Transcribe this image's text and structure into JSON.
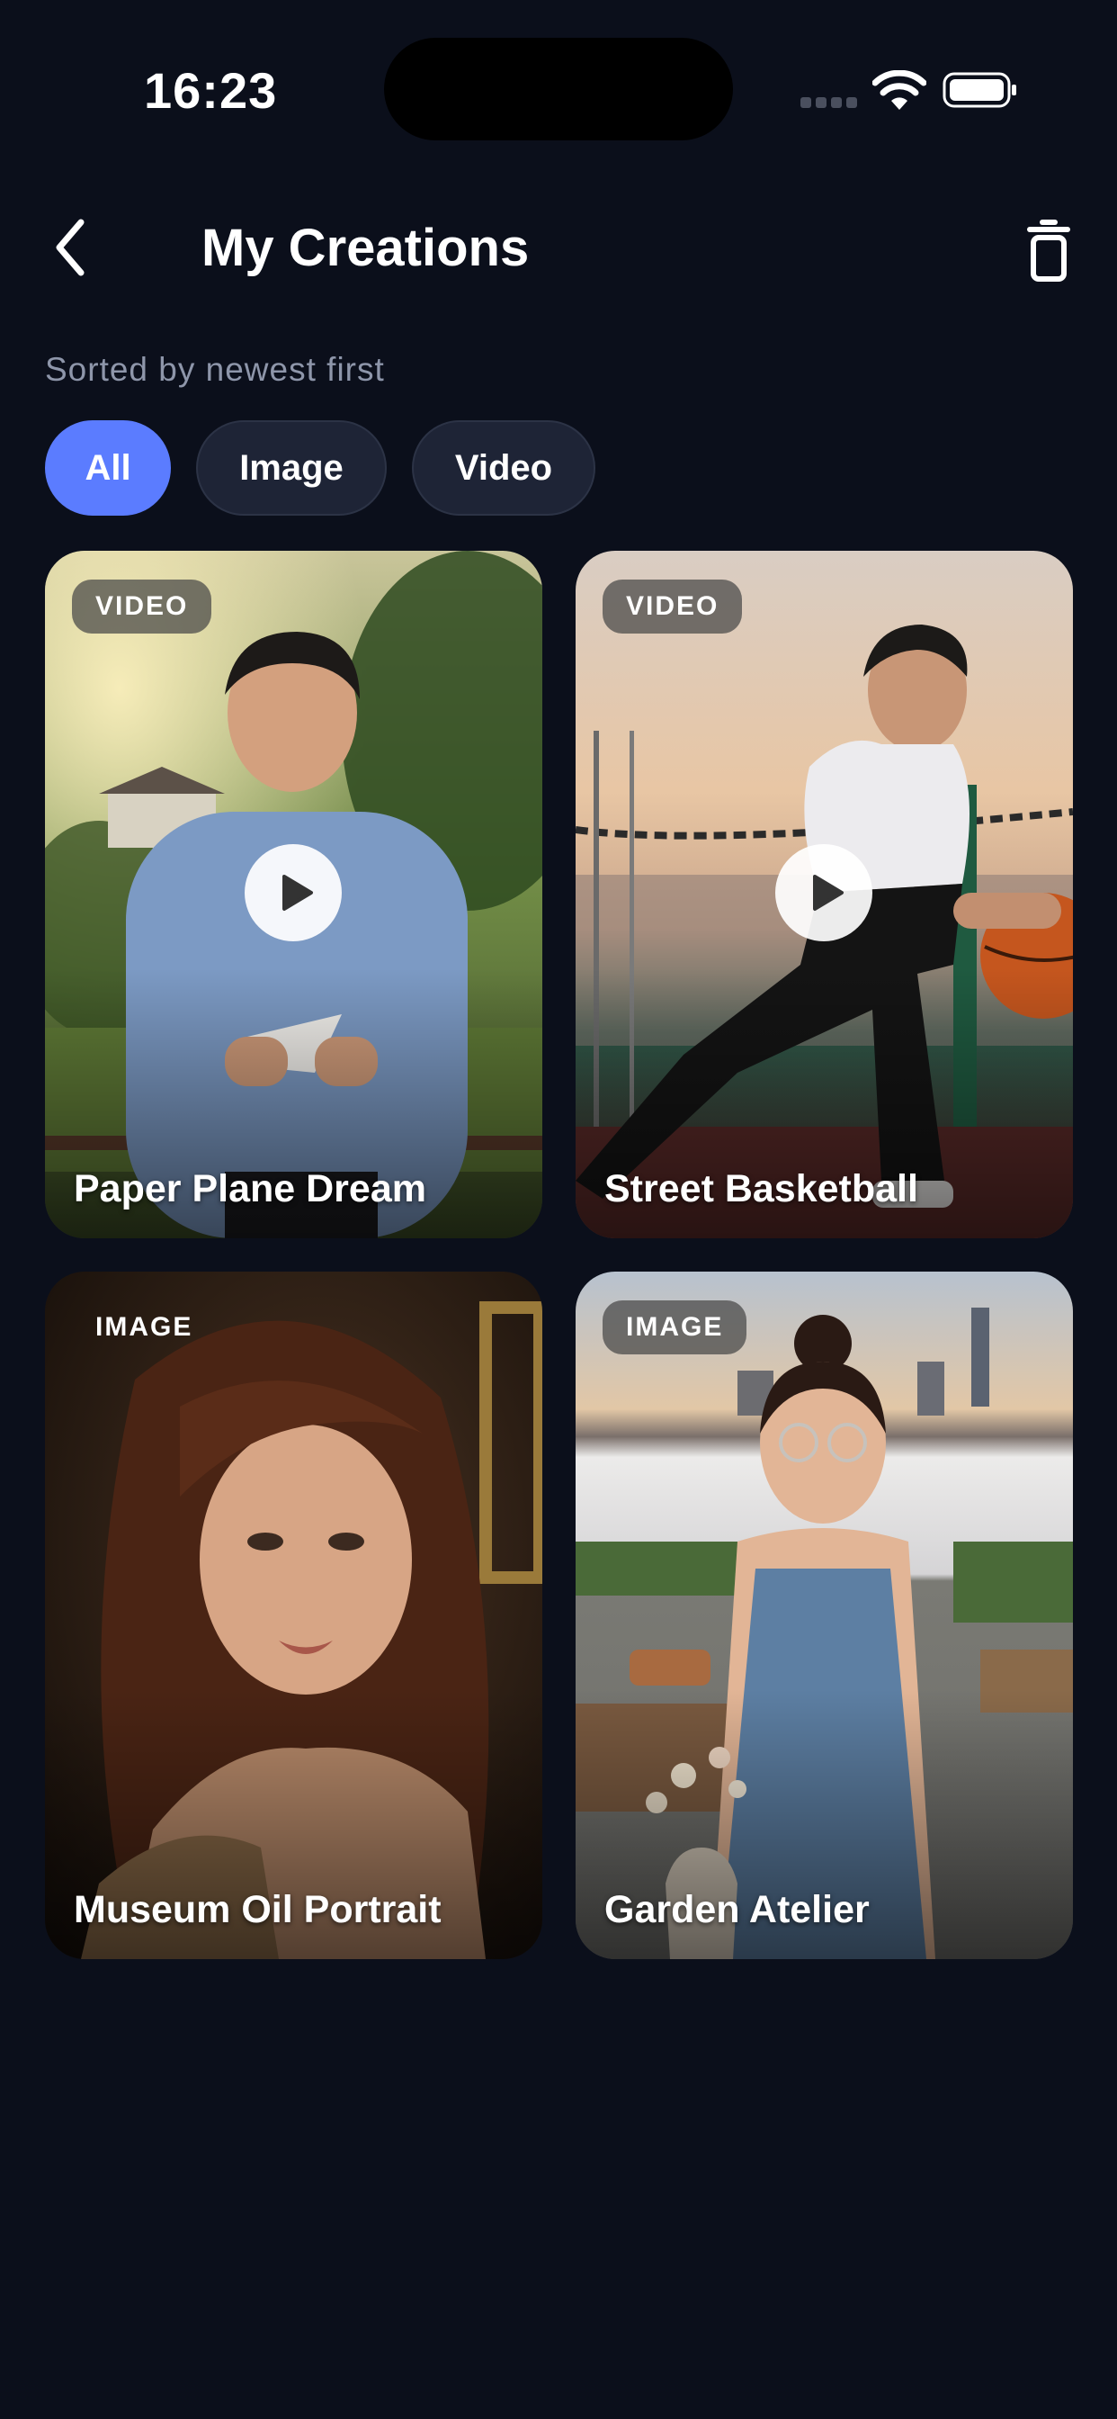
{
  "status_bar": {
    "time": "16:23"
  },
  "header": {
    "title": "My Creations",
    "back_icon": "chevron-left-icon",
    "trash_icon": "trash-icon"
  },
  "subtitle": "Sorted by newest first",
  "filters": {
    "selected": "All",
    "options": [
      "All",
      "Image",
      "Video"
    ]
  },
  "colors": {
    "accent": "#5b7cff",
    "background": "#0b0f1b",
    "chip_bg": "#1e2436"
  },
  "creations": [
    {
      "type": "VIDEO",
      "title": "Paper Plane Dream",
      "playable": true
    },
    {
      "type": "VIDEO",
      "title": "Street Basketball",
      "playable": true
    },
    {
      "type": "IMAGE",
      "title": "Museum Oil Portrait",
      "playable": false
    },
    {
      "type": "IMAGE",
      "title": "Garden Atelier",
      "playable": false
    }
  ]
}
